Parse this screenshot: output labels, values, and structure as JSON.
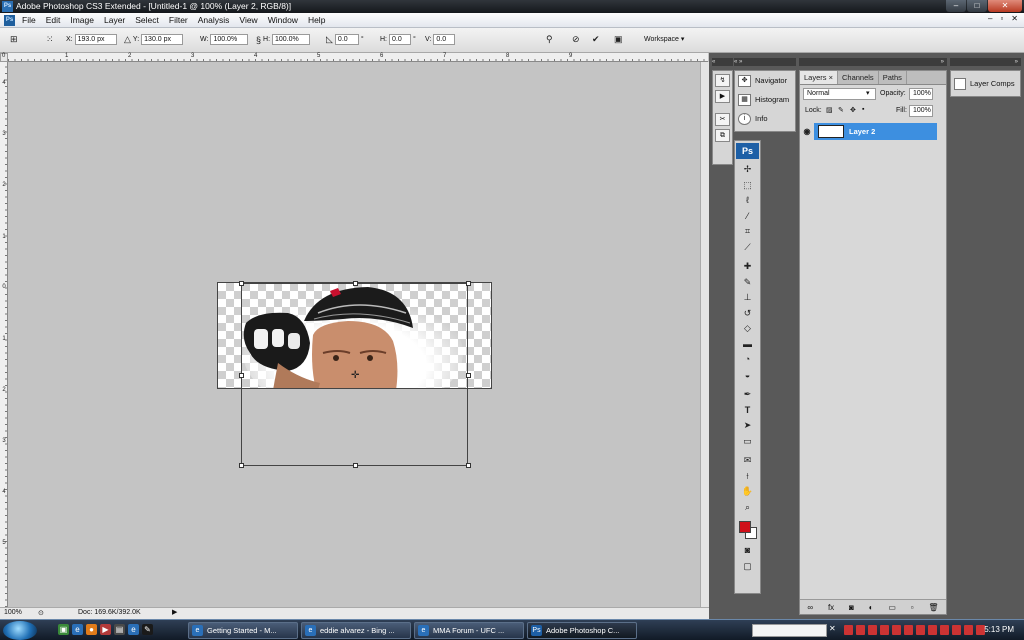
{
  "window": {
    "title": "Adobe Photoshop CS3 Extended - [Untitled-1 @ 100% (Layer 2, RGB/8)]",
    "app_icon": "Ps"
  },
  "menu": [
    "File",
    "Edit",
    "Image",
    "Layer",
    "Select",
    "Filter",
    "Analysis",
    "View",
    "Window",
    "Help"
  ],
  "options": {
    "x_label": "X:",
    "x_value": "193.0 px",
    "y_label": "Y:",
    "y_value": "130.0 px",
    "w_label": "W:",
    "w_value": "100.0%",
    "h_label": "H:",
    "h_value": "100.0%",
    "angle_value": "0.0",
    "degree": "°",
    "hskew_label": "H:",
    "hskew_value": "0.0",
    "vskew_label": "V:",
    "vskew_value": "0.0",
    "workspace_label": "Workspace ▾"
  },
  "ruler": {
    "top_labels": [
      "0",
      "1",
      "2",
      "3",
      "4",
      "5",
      "6",
      "7",
      "8",
      "9"
    ],
    "left_labels": [
      "4",
      "3",
      "2",
      "1",
      "0",
      "1",
      "2",
      "3",
      "4",
      "5"
    ]
  },
  "status": {
    "zoom": "100%",
    "doc": "Doc: 169.6K/392.0K"
  },
  "nav_panel": {
    "items": [
      "Navigator",
      "Histogram",
      "Info"
    ]
  },
  "layers_panel": {
    "tabs": [
      "Layers ×",
      "Channels",
      "Paths"
    ],
    "blend_mode": "Normal",
    "opacity_label": "Opacity:",
    "opacity_value": "100%",
    "lock_label": "Lock:",
    "fill_label": "Fill:",
    "fill_value": "100%",
    "layer_name": "Layer 2"
  },
  "comps_panel": {
    "label": "Layer Comps"
  },
  "toolbox": {
    "logo": "Ps",
    "fg_color": "#d0101a",
    "bg_color": "#ffffff"
  },
  "taskbar": {
    "buttons": [
      "Getting Started - M...",
      "eddie alvarez - Bing ...",
      "MMA Forum - UFC ...",
      "Adobe Photoshop C..."
    ],
    "clock": "5:13 PM"
  },
  "colors": {
    "selected_layer": "#3d8fe0",
    "titlebar": "#1f2328",
    "dock": "#595959"
  }
}
